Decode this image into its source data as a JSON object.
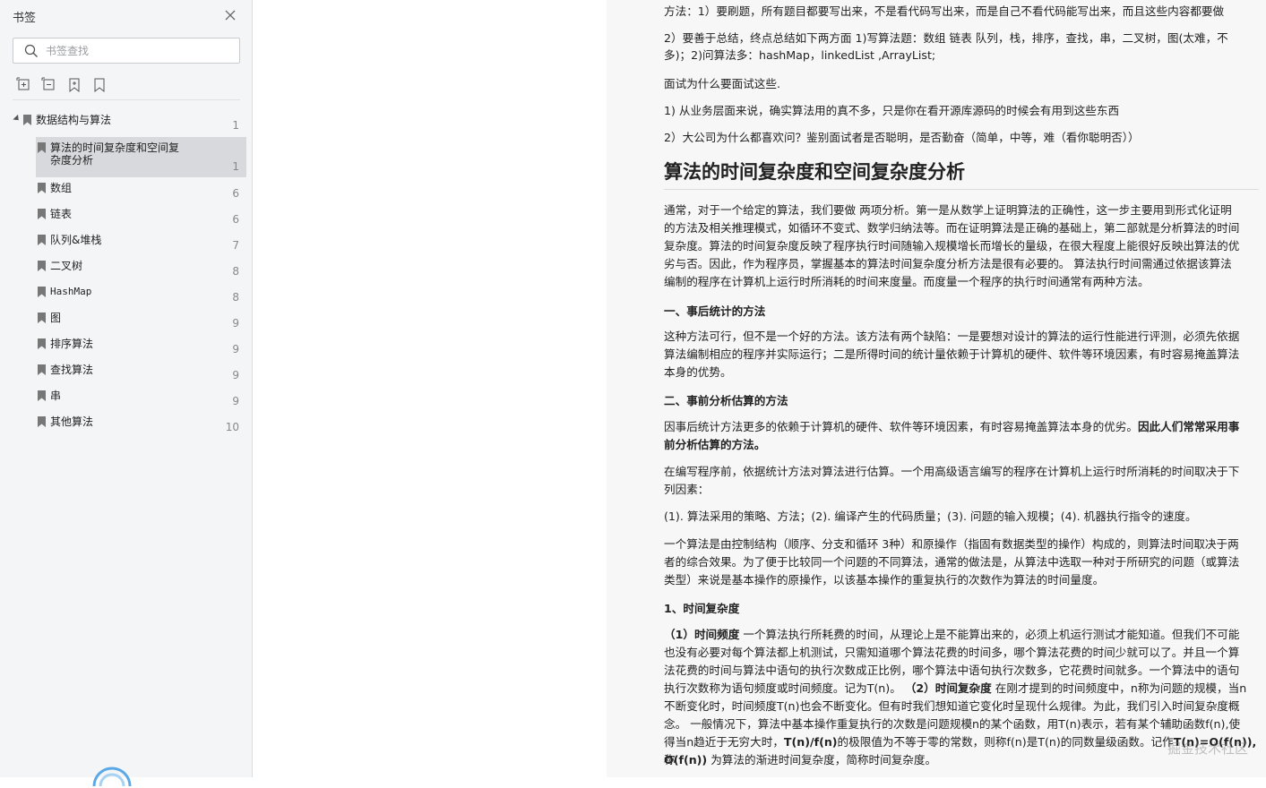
{
  "sidebar": {
    "title": "书签",
    "search_placeholder": "书签查找",
    "tree": [
      {
        "label": "数据结构与算法",
        "page": "1",
        "level": 0
      },
      {
        "label": "算法的时间复杂度和空间复杂度分析",
        "label_line1": "算法的时间复杂度和空间复",
        "label_line2": "杂度分析",
        "page": "1",
        "level": 1,
        "selected": true
      },
      {
        "label": "数组",
        "page": "6",
        "level": 1
      },
      {
        "label": "链表",
        "page": "6",
        "level": 1
      },
      {
        "label": "队列&堆栈",
        "page": "7",
        "level": 1
      },
      {
        "label": "二叉树",
        "page": "8",
        "level": 1
      },
      {
        "label": "HashMap",
        "page": "8",
        "level": 1
      },
      {
        "label": "图",
        "page": "9",
        "level": 1
      },
      {
        "label": "排序算法",
        "page": "9",
        "level": 1
      },
      {
        "label": "查找算法",
        "page": "9",
        "level": 1
      },
      {
        "label": "串",
        "page": "9",
        "level": 1
      },
      {
        "label": "其他算法",
        "page": "10",
        "level": 1
      }
    ]
  },
  "document": {
    "p1": "方法：1）要刷题，所有题目都要写出来，不是看代码写出来，而是自己不看代码能写出来，而且这些内容都要做",
    "p2a": "2）要善于总结，终点总结如下两方面 1)写算法题：数组 链表 队列，栈，排序，查找，串，二叉树，图(太难，不",
    "p2b": "多)；2)问算法多：hashMap，linkedList ,ArrayList;",
    "p3": "面试为什么要面试这些.",
    "p4": "1) 从业务层面来说，确实算法用的真不多，只是你在看开源库源码的时候会有用到这些东西",
    "p5": "2）大公司为什么都喜欢问？鉴别面试者是否聪明，是否勤奋（简单，中等，难（看你聪明否））",
    "heading": "算法的时间复杂度和空间复杂度分析",
    "intro": [
      "通常，对于一个给定的算法，我们要做 两项分析。第一是从数学上证明算法的正确性，这一步主要用到形式化证明",
      "的方法及相关推理模式，如循环不变式、数学归纳法等。而在证明算法是正确的基础上，第二部就是分析算法的时间",
      "复杂度。算法的时间复杂度反映了程序执行时间随输入规模增长而增长的量级，在很大程度上能很好反映出算法的优",
      "劣与否。因此，作为程序员，掌握基本的算法时间复杂度分析方法是很有必要的。 算法执行时间需通过依据该算法",
      "编制的程序在计算机上运行时所消耗的时间来度量。而度量一个程序的执行时间通常有两种方法。"
    ],
    "sub1": "一、事后统计的方法",
    "s1": [
      "这种方法可行，但不是一个好的方法。该方法有两个缺陷：一是要想对设计的算法的运行性能进行评测，必须先依据",
      "算法编制相应的程序并实际运行；二是所得时间的统计量依赖于计算机的硬件、软件等环境因素，有时容易掩盖算法",
      "本身的优势。"
    ],
    "sub2": "二、事前分析估算的方法",
    "s2a": "因事后统计方法更多的依赖于计算机的硬件、软件等环境因素，有时容易掩盖算法本身的优劣。",
    "s2a_bold": "因此人们常常采用事",
    "s2a2": "前分析估算的方法。",
    "s2b": [
      "在编写程序前，依据统计方法对算法进行估算。一个用高级语言编写的程序在计算机上运行时所消耗的时间取决于下",
      "列因素："
    ],
    "s2c": "(1). 算法采用的策略、方法；(2). 编译产生的代码质量；(3). 问题的输入规模；(4). 机器执行指令的速度。",
    "s2d": [
      "一个算法是由控制结构（顺序、分支和循环 3种）和原操作（指固有数据类型的操作）构成的，则算法时间取决于两",
      "者的综合效果。为了便于比较同一个问题的不同算法，通常的做法是，从算法中选取一种对于所研究的问题（或算法",
      "类型）来说是基本操作的原操作，以该基本操作的重复执行的次数作为算法的时间量度。"
    ],
    "sub3": "1、时间复杂度",
    "t1_bold": "（1）时间频度",
    "t1": [
      " 一个算法执行所耗费的时间，从理论上是不能算出来的，必须上机运行测试才能知道。但我们不可能",
      "也没有必要对每个算法都上机测试，只需知道哪个算法花费的时间多，哪个算法花费的时间少就可以了。并且一个算",
      "法花费的时间与算法中语句的执行次数成正比例，哪个算法中语句执行次数多，它花费时间就多。一个算法中的语句",
      "执行次数称为语句频度或时间频度。记为T(n)。"
    ],
    "t2_bold": "（2）时间复杂度",
    "t2": [
      " 在刚才提到的时间频度中，n称为问题的规模，当n",
      "不断变化时，时间频度T(n)也会不断变化。但有时我们想知道它变化时呈现什么规律。为此，我们引入时间复杂度概",
      "念。 一般情况下，算法中基本操作重复执行的次数是问题规模n的某个函数，用T(n)表示，若有某个辅助函数f(n),使",
      "得当n趋近于无穷大时，"
    ],
    "t3_bold": "T(n)/f(n)",
    "t3": "的极限值为不等于零的常数，则称f(n)是T(n)的同数量级函数。记作",
    "t3_bold2": "T(n)=O(f(n)),",
    "t3_end": "称",
    "t4_bold": "O(f(n))",
    "t4": " 为算法的渐进时间复杂度，简称时间复杂度。",
    "watermark": "掘金技术社区"
  }
}
